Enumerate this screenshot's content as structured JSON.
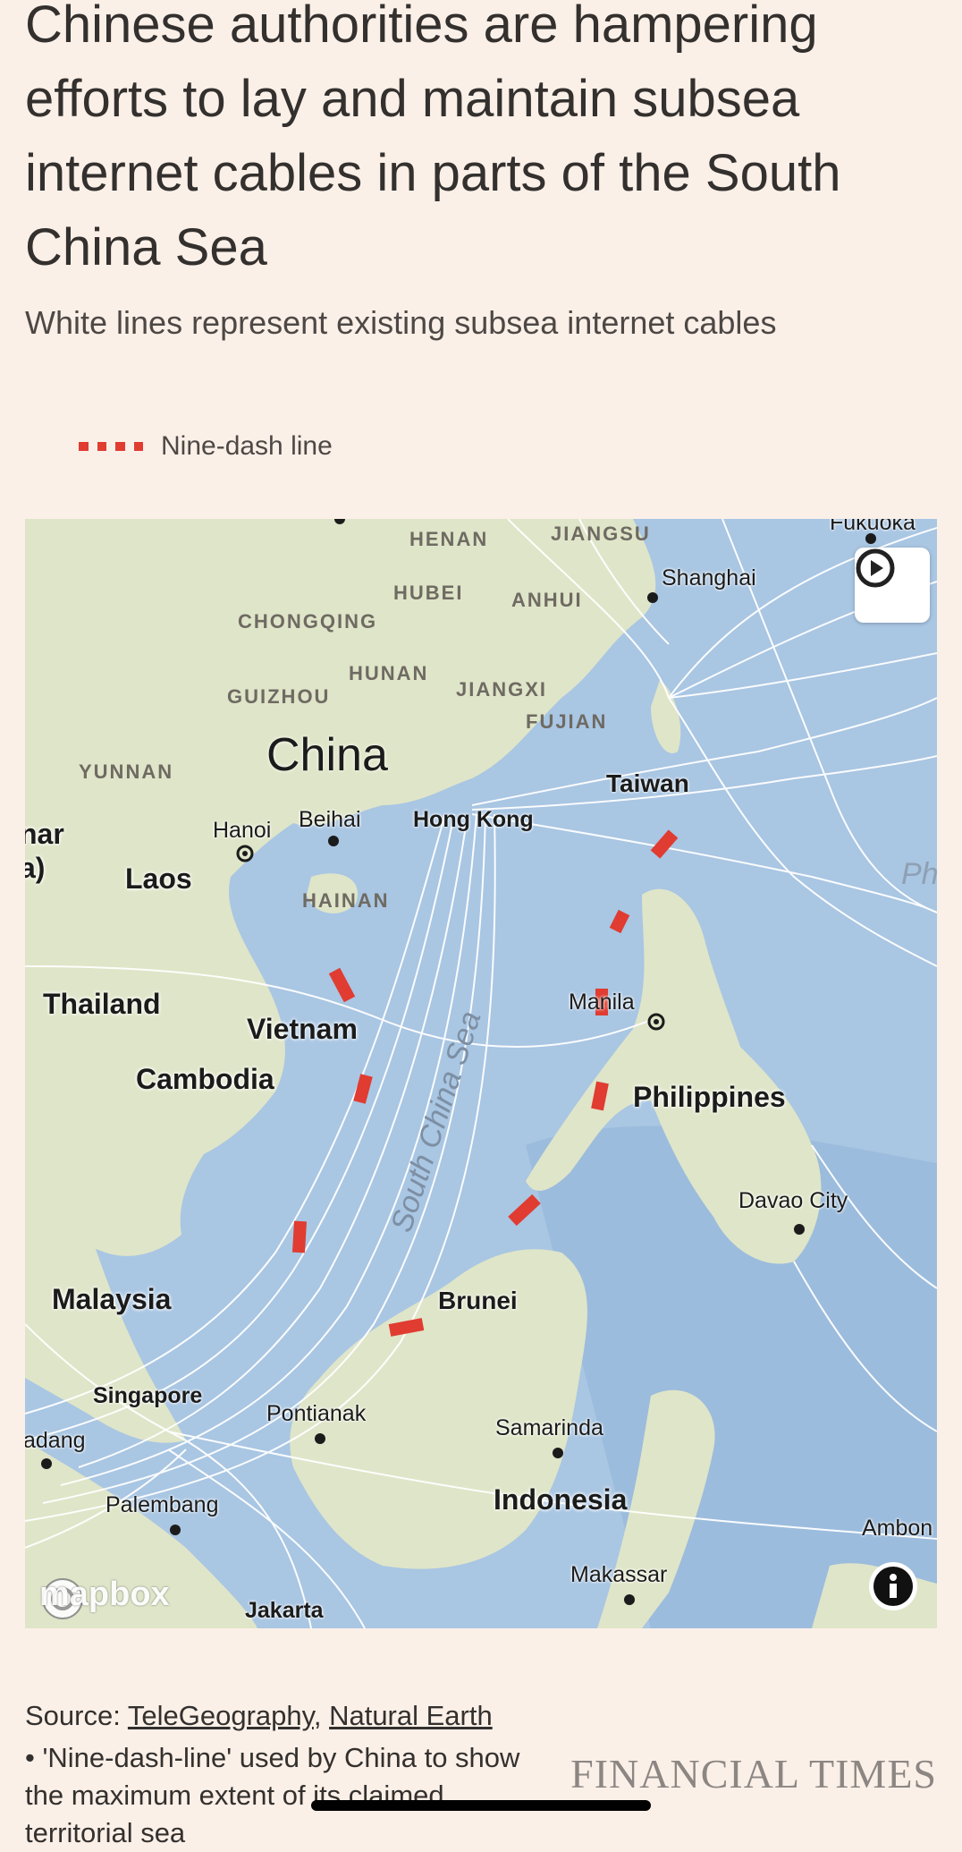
{
  "article": {
    "title": "Chinese authorities are hampering efforts to lay and maintain subsea internet cables in parts of the South China Sea",
    "subtitle": "White lines represent existing subsea internet cables"
  },
  "legend": {
    "label": "Nine-dash line",
    "color": "#e03c31"
  },
  "map": {
    "provinces": [
      "HENAN",
      "JIANGSU",
      "HUBEI",
      "ANHUI",
      "CHONGQING",
      "HUNAN",
      "JIANGXI",
      "GUIZHOU",
      "FUJIAN",
      "YUNNAN",
      "HAINAN"
    ],
    "countries": [
      "China",
      "Laos",
      "Thailand",
      "Vietnam",
      "Cambodia",
      "Philippines",
      "Malaysia",
      "Indonesia",
      "Brunei",
      "Taiwan"
    ],
    "edge_fragments": [
      "nar",
      "a)",
      "Ph"
    ],
    "cities": [
      "Fukuoka",
      "Shanghai",
      "Hanoi",
      "Beihai",
      "Hong Kong",
      "Manila",
      "Davao City",
      "Singapore",
      "Pontianak",
      "Samarinda",
      "adang",
      "Palembang",
      "Makassar",
      "Ambon",
      "Jakarta"
    ],
    "sea_label": "South China Sea",
    "attribution": "mapbox",
    "play_icon": "play-circle-icon",
    "info_icon": "info-icon"
  },
  "footer": {
    "source_prefix": "Source: ",
    "source_1": "TeleGeography",
    "source_sep": ", ",
    "source_2": "Natural Earth",
    "note": "• 'Nine-dash-line' used by China to show the maximum extent of its claimed territorial sea",
    "brand": "FINANCIAL TIMES"
  }
}
